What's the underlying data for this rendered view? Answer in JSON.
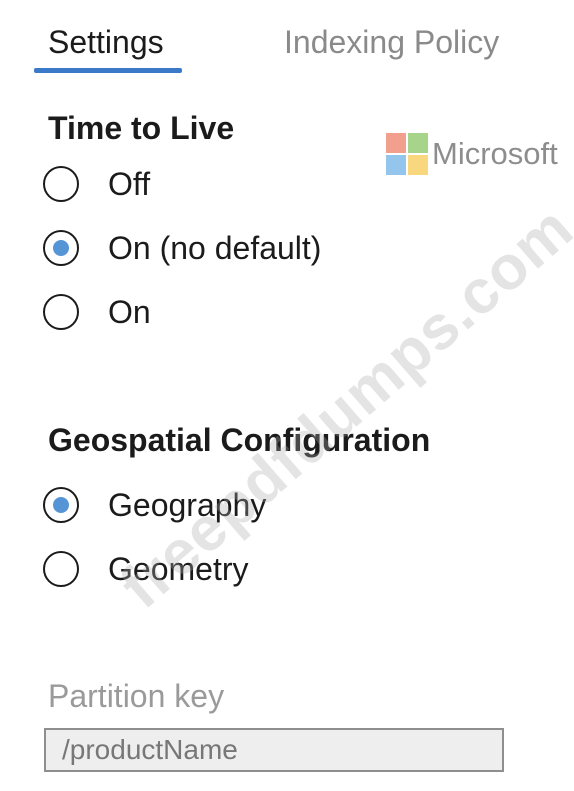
{
  "tabs": {
    "settings": "Settings",
    "indexing_policy": "Indexing Policy",
    "active": "Settings"
  },
  "time_to_live": {
    "title": "Time to Live",
    "options": [
      "Off",
      "On (no default)",
      "On"
    ],
    "selected": "On (no default)"
  },
  "geospatial": {
    "title": "Geospatial Configuration",
    "options": [
      "Geography",
      "Geometry"
    ],
    "selected": "Geography"
  },
  "partition_key": {
    "label": "Partition key",
    "value": "/productName"
  },
  "logo": {
    "text": "Microsoft",
    "colors": [
      "#f2a08d",
      "#a5d48a",
      "#94c5ec",
      "#f8d77f"
    ]
  },
  "watermark": "freepdfdumps.com",
  "colors": {
    "accent": "#3a7ac8",
    "radio_selected": "#5595d6"
  }
}
